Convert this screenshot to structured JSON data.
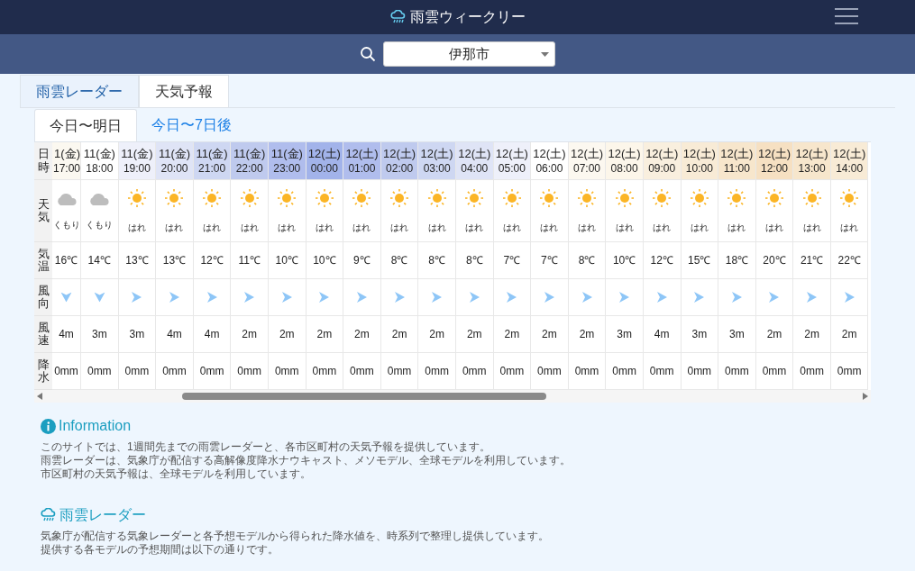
{
  "header": {
    "title": "雨雲ウィークリー"
  },
  "search": {
    "value": "伊那市"
  },
  "main_tabs": [
    {
      "label": "雨雲レーダー",
      "selected": false
    },
    {
      "label": "天気予報",
      "selected": true
    }
  ],
  "sub_tabs": [
    {
      "label": "今日〜明日",
      "selected": true
    },
    {
      "label": "今日〜7日後",
      "selected": false
    }
  ],
  "row_labels": [
    "日時",
    "天気",
    "気温",
    "風向",
    "風速",
    "降水"
  ],
  "columns": [
    {
      "date": "1(金)",
      "time": "17:00",
      "color": "#fbf8f0",
      "weather": {
        "kind": "cloudy",
        "label": "くもり"
      },
      "temp": "16℃",
      "wind_arrow": {
        "kind": "down"
      },
      "wind": "4m",
      "precip": "0mm"
    },
    {
      "date": "11(金)",
      "time": "18:00",
      "color": "#ffffff",
      "weather": {
        "kind": "cloudy",
        "label": "くもり"
      },
      "temp": "14℃",
      "wind_arrow": {
        "kind": "down"
      },
      "wind": "3m",
      "precip": "0mm"
    },
    {
      "date": "11(金)",
      "time": "19:00",
      "color": "#eef0fa",
      "weather": {
        "kind": "sunny",
        "label": "はれ"
      },
      "temp": "13℃",
      "wind_arrow": {
        "kind": "right"
      },
      "wind": "3m",
      "precip": "0mm"
    },
    {
      "date": "11(金)",
      "time": "20:00",
      "color": "#dfe4f6",
      "weather": {
        "kind": "sunny",
        "label": "はれ"
      },
      "temp": "13℃",
      "wind_arrow": {
        "kind": "right"
      },
      "wind": "4m",
      "precip": "0mm"
    },
    {
      "date": "11(金)",
      "time": "21:00",
      "color": "#ced7f2",
      "weather": {
        "kind": "sunny",
        "label": "はれ"
      },
      "temp": "12℃",
      "wind_arrow": {
        "kind": "right"
      },
      "wind": "4m",
      "precip": "0mm"
    },
    {
      "date": "11(金)",
      "time": "22:00",
      "color": "#bfcaee",
      "weather": {
        "kind": "sunny",
        "label": "はれ"
      },
      "temp": "11℃",
      "wind_arrow": {
        "kind": "right"
      },
      "wind": "2m",
      "precip": "0mm"
    },
    {
      "date": "11(金)",
      "time": "23:00",
      "color": "#b0bded",
      "weather": {
        "kind": "sunny",
        "label": "はれ"
      },
      "temp": "10℃",
      "wind_arrow": {
        "kind": "right"
      },
      "wind": "2m",
      "precip": "0mm"
    },
    {
      "date": "12(土)",
      "time": "00:00",
      "color": "#a2b3ea",
      "weather": {
        "kind": "sunny",
        "label": "はれ"
      },
      "temp": "10℃",
      "wind_arrow": {
        "kind": "right"
      },
      "wind": "2m",
      "precip": "0mm"
    },
    {
      "date": "12(土)",
      "time": "01:00",
      "color": "#b0bded",
      "weather": {
        "kind": "sunny",
        "label": "はれ"
      },
      "temp": "9℃",
      "wind_arrow": {
        "kind": "right"
      },
      "wind": "2m",
      "precip": "0mm"
    },
    {
      "date": "12(土)",
      "time": "02:00",
      "color": "#bfcaee",
      "weather": {
        "kind": "sunny",
        "label": "はれ"
      },
      "temp": "8℃",
      "wind_arrow": {
        "kind": "right"
      },
      "wind": "2m",
      "precip": "0mm"
    },
    {
      "date": "12(土)",
      "time": "03:00",
      "color": "#ced7f2",
      "weather": {
        "kind": "sunny",
        "label": "はれ"
      },
      "temp": "8℃",
      "wind_arrow": {
        "kind": "right"
      },
      "wind": "2m",
      "precip": "0mm"
    },
    {
      "date": "12(土)",
      "time": "04:00",
      "color": "#dfe4f6",
      "weather": {
        "kind": "sunny",
        "label": "はれ"
      },
      "temp": "8℃",
      "wind_arrow": {
        "kind": "right"
      },
      "wind": "2m",
      "precip": "0mm"
    },
    {
      "date": "12(土)",
      "time": "05:00",
      "color": "#eef0fa",
      "weather": {
        "kind": "sunny",
        "label": "はれ"
      },
      "temp": "7℃",
      "wind_arrow": {
        "kind": "right"
      },
      "wind": "2m",
      "precip": "0mm"
    },
    {
      "date": "12(土)",
      "time": "06:00",
      "color": "#ffffff",
      "weather": {
        "kind": "sunny",
        "label": "はれ"
      },
      "temp": "7℃",
      "wind_arrow": {
        "kind": "right"
      },
      "wind": "2m",
      "precip": "0mm"
    },
    {
      "date": "12(土)",
      "time": "07:00",
      "color": "#fcf8f0",
      "weather": {
        "kind": "sunny",
        "label": "はれ"
      },
      "temp": "8℃",
      "wind_arrow": {
        "kind": "right"
      },
      "wind": "2m",
      "precip": "0mm"
    },
    {
      "date": "12(土)",
      "time": "08:00",
      "color": "#fcf6ea",
      "weather": {
        "kind": "sunny",
        "label": "はれ"
      },
      "temp": "10℃",
      "wind_arrow": {
        "kind": "right"
      },
      "wind": "3m",
      "precip": "0mm"
    },
    {
      "date": "12(土)",
      "time": "09:00",
      "color": "#f9efde",
      "weather": {
        "kind": "sunny",
        "label": "はれ"
      },
      "temp": "12℃",
      "wind_arrow": {
        "kind": "right"
      },
      "wind": "4m",
      "precip": "0mm"
    },
    {
      "date": "12(土)",
      "time": "10:00",
      "color": "#f8ebd6",
      "weather": {
        "kind": "sunny",
        "label": "はれ"
      },
      "temp": "15℃",
      "wind_arrow": {
        "kind": "right"
      },
      "wind": "3m",
      "precip": "0mm"
    },
    {
      "date": "12(土)",
      "time": "11:00",
      "color": "#f7e6cc",
      "weather": {
        "kind": "sunny",
        "label": "はれ"
      },
      "temp": "18℃",
      "wind_arrow": {
        "kind": "right"
      },
      "wind": "3m",
      "precip": "0mm"
    },
    {
      "date": "12(土)",
      "time": "12:00",
      "color": "#f6e0c2",
      "weather": {
        "kind": "sunny",
        "label": "はれ"
      },
      "temp": "20℃",
      "wind_arrow": {
        "kind": "right"
      },
      "wind": "2m",
      "precip": "0mm"
    },
    {
      "date": "12(土)",
      "time": "13:00",
      "color": "#f7e6cc",
      "weather": {
        "kind": "sunny",
        "label": "はれ"
      },
      "temp": "21℃",
      "wind_arrow": {
        "kind": "right"
      },
      "wind": "2m",
      "precip": "0mm"
    },
    {
      "date": "12(土)",
      "time": "14:00",
      "color": "#f8ebd6",
      "weather": {
        "kind": "sunny",
        "label": "はれ"
      },
      "temp": "22℃",
      "wind_arrow": {
        "kind": "right"
      },
      "wind": "2m",
      "precip": "0mm"
    }
  ],
  "sections": [
    {
      "kind": "info",
      "title": "Information",
      "lines": [
        "このサイトでは、1週間先までの雨雲レーダーと、各市区町村の天気予報を提供しています。",
        "雨雲レーダーは、気象庁が配信する高解像度降水ナウキャスト、メソモデル、全球モデルを利用しています。",
        "市区町村の天気予報は、全球モデルを利用しています。"
      ]
    },
    {
      "kind": "rain",
      "title": "雨雲レーダー",
      "lines": [
        "気象庁が配信する気象レーダーと各予想モデルから得られた降水値を、時系列で整理し提供しています。",
        "提供する各モデルの予想期間は以下の通りです。"
      ]
    }
  ]
}
